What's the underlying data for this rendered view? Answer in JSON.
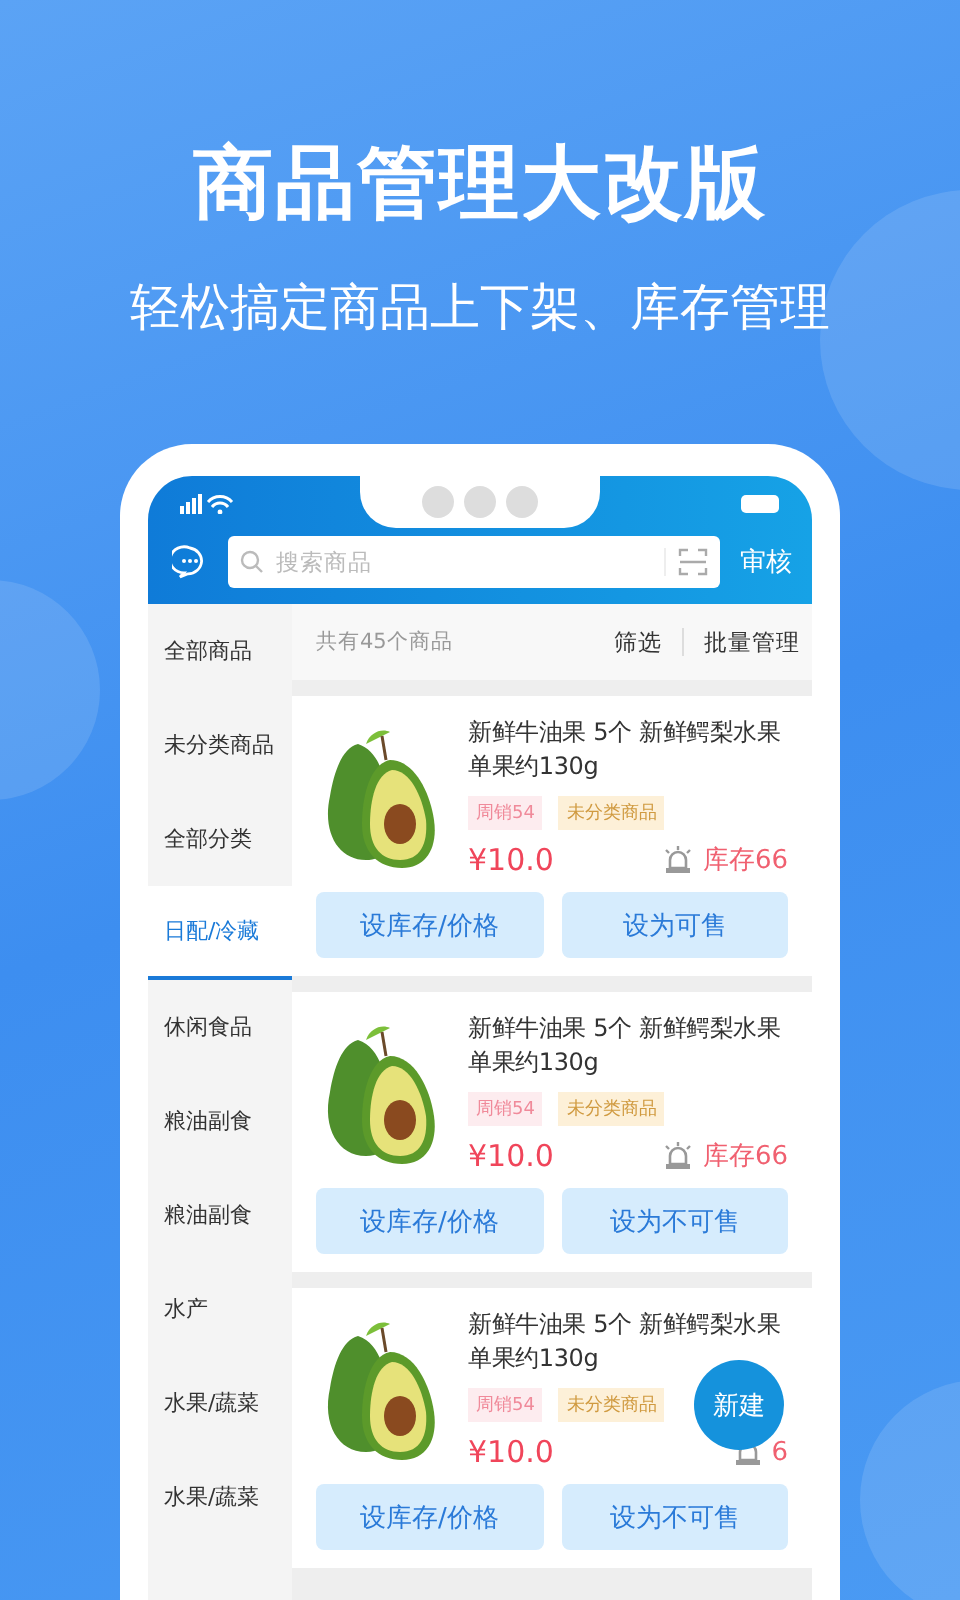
{
  "promo": {
    "title": "商品管理大改版",
    "subtitle": "轻松搞定商品上下架、库存管理"
  },
  "header": {
    "search_placeholder": "搜索商品",
    "action": "审核"
  },
  "toolbar": {
    "count": "共有45个商品",
    "filter": "筛选",
    "batch": "批量管理"
  },
  "sidebar": {
    "items": [
      {
        "label": "全部商品",
        "selected": false
      },
      {
        "label": "未分类商品",
        "selected": false
      },
      {
        "label": "全部分类",
        "selected": false
      },
      {
        "label": "日配/冷藏",
        "selected": true
      },
      {
        "label": "休闲食品",
        "selected": false
      },
      {
        "label": "粮油副食",
        "selected": false
      },
      {
        "label": "粮油副食",
        "selected": false
      },
      {
        "label": "水产",
        "selected": false
      },
      {
        "label": "水果/蔬菜",
        "selected": false
      },
      {
        "label": "水果/蔬菜",
        "selected": false
      }
    ]
  },
  "products": [
    {
      "title": "新鲜牛油果 5个 新鲜鳄梨水果单果约130g",
      "sales": "周销54",
      "tag": "未分类商品",
      "price": "¥10.0",
      "stock": "库存66",
      "buttons": [
        "设库存/价格",
        "设为可售"
      ]
    },
    {
      "title": "新鲜牛油果 5个 新鲜鳄梨水果单果约130g",
      "sales": "周销54",
      "tag": "未分类商品",
      "price": "¥10.0",
      "stock": "库存66",
      "buttons": [
        "设库存/价格",
        "设为不可售"
      ]
    },
    {
      "title": "新鲜牛油果 5个 新鲜鳄梨水果单果约130g",
      "sales": "周销54",
      "tag": "未分类商品",
      "price": "¥10.0",
      "stock": "6",
      "buttons": [
        "设库存/价格",
        "设为不可售"
      ]
    }
  ],
  "fab": "新建"
}
